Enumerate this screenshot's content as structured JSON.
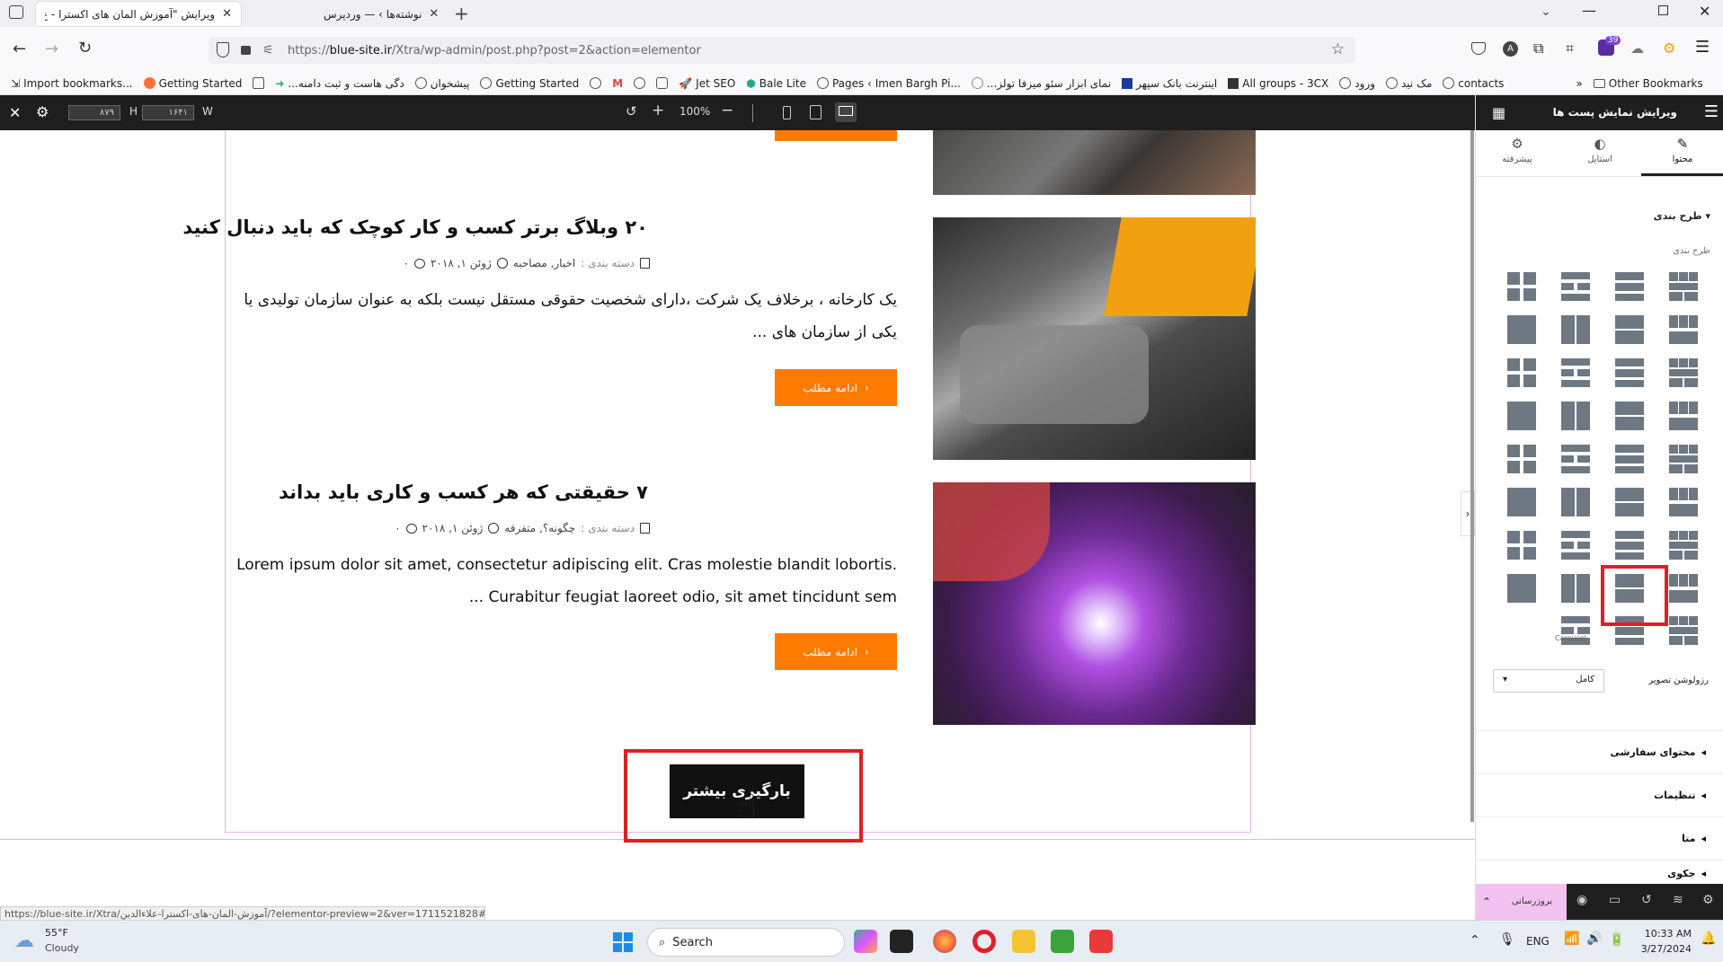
{
  "browser": {
    "tabs": [
      {
        "label": "ویرایش \"آموزش المان های اکسترا - ع",
        "active": true
      },
      {
        "label": "نوشته‌ها › — وردپرس",
        "active": false
      }
    ],
    "url_prefix": "https://",
    "url_domain": "blue-site.ir",
    "url_path": "/Xtra/wp-admin/post.php?post=2&action=elementor",
    "bookmarks": [
      "Import bookmarks...",
      "Getting Started",
      "...دگی هاست و ثبت دامنه",
      "پیشخوان",
      "Getting Started",
      "Jet SEO",
      "Bale Lite",
      "Pages ‹ Imen Bargh Pi...",
      "...نمای ابزار سئو میزفا تولز",
      "اینترنت بانک سپهر",
      "All groups - 3CX",
      "ورود",
      "مک نید",
      "contacts"
    ],
    "other_bookmarks": "Other Bookmarks",
    "extension_badge": "39"
  },
  "editor_topbar": {
    "width_label": "W",
    "width_value": "۱۶۴۱",
    "height_label": "H",
    "height_value": "۸۷۹",
    "zoom": "100%"
  },
  "panel": {
    "title": "ویرایش نمایش پست ها",
    "tabs": [
      "محتوا",
      "استایل",
      "پیشرفته"
    ],
    "section_layout": "طرح بندی",
    "layout_sublabel": "طرح بندی",
    "carousel_label": "Carousel",
    "image_resolution_label": "رزولوشن تصویر",
    "image_resolution_value": "کامل",
    "sections": [
      "محتوای سفارشی",
      "تنظیمات",
      "متا",
      "جکوی"
    ],
    "update_button": "بروزرسانی"
  },
  "posts": [
    {
      "title": "۲۰ وبلاگ برتر کسب و کار کوچک که باید دنبال کنید",
      "category_label": "دسته بندی :",
      "categories": "اخبار, مصاحبه",
      "date": "ژوئن ۱, ۲۰۱۸",
      "comments": "۰",
      "excerpt": "یک کارخانه ، برخلاف یک شرکت ،دارای شخصیت حقوقی مستقل نیست بلکه به عنوان سازمان تولیدی یا یکی از سازمان های ...",
      "button": "ادامه مطلب"
    },
    {
      "title": "۷ حقیقتی که هر کسب و کاری باید بداند",
      "category_label": "دسته بندی :",
      "categories": "چگونه؟, متفرقه",
      "date": "ژوئن ۱, ۲۰۱۸",
      "comments": "۰",
      "excerpt": "Lorem ipsum dolor sit amet, consectetur adipiscing elit. Cras molestie blandit lobortis. Curabitur feugiat laoreet odio, sit amet tincidunt sem ...",
      "button": "ادامه مطلب"
    }
  ],
  "load_more": "بارگیری بیشتر",
  "status_url": "https://blue-site.ir/Xtra/آموزش-المان-های-اکسترا-علاءالدین/?elementor-preview=2&ver=1711521828#",
  "taskbar": {
    "weather_temp": "55°F",
    "weather_desc": "Cloudy",
    "search": "Search",
    "lang": "ENG",
    "time": "10:33 AM",
    "date": "3/27/2024"
  },
  "colors": {
    "accent": "#ff7a00",
    "highlight": "#e02020",
    "editor_dark": "#1e1e1e",
    "update_bg": "#f3c2f0"
  }
}
